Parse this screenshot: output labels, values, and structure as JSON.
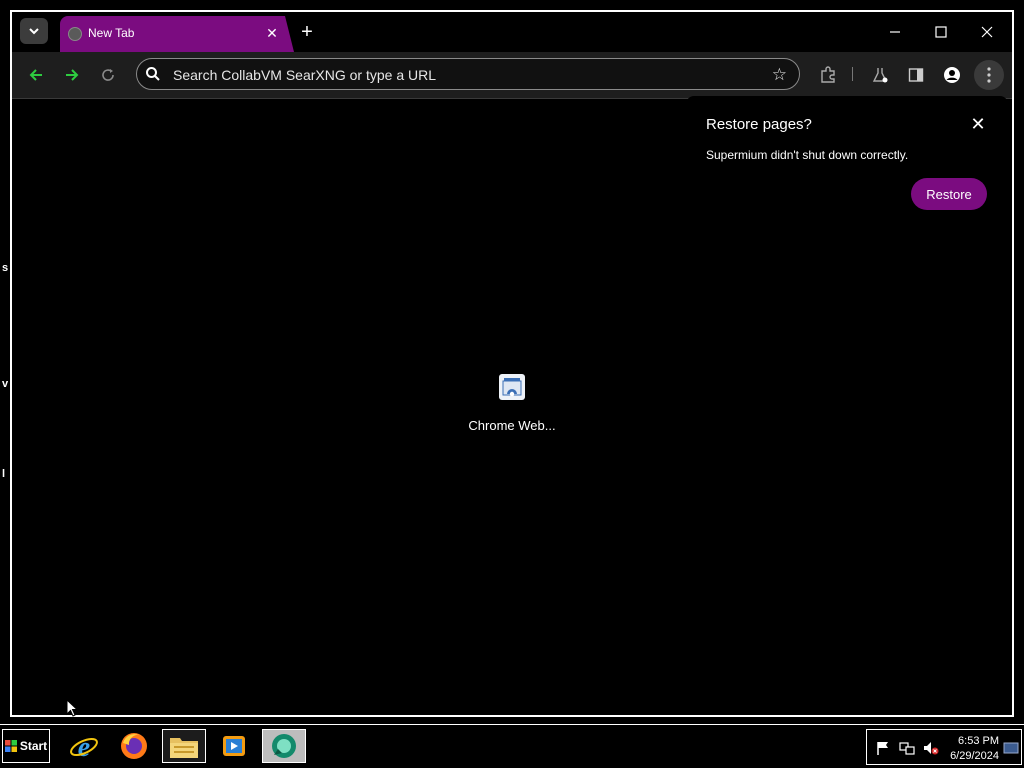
{
  "browser": {
    "tab": {
      "title": "New Tab"
    },
    "omnibox": {
      "placeholder": "Search CollabVM SearXNG or type a URL"
    },
    "colors": {
      "accent": "#7b0c80",
      "back_forward": "#2ecc40"
    }
  },
  "content": {
    "shortcut": {
      "label": "Chrome Web..."
    }
  },
  "restore_bubble": {
    "title": "Restore pages?",
    "message": "Supermium didn't shut down correctly.",
    "button_label": "Restore"
  },
  "taskbar": {
    "start_label": "Start",
    "clock": {
      "time": "6:53 PM",
      "date": "6/29/2024"
    },
    "apps": [
      "internet-explorer",
      "firefox",
      "file-explorer",
      "media-player",
      "supermium"
    ]
  }
}
